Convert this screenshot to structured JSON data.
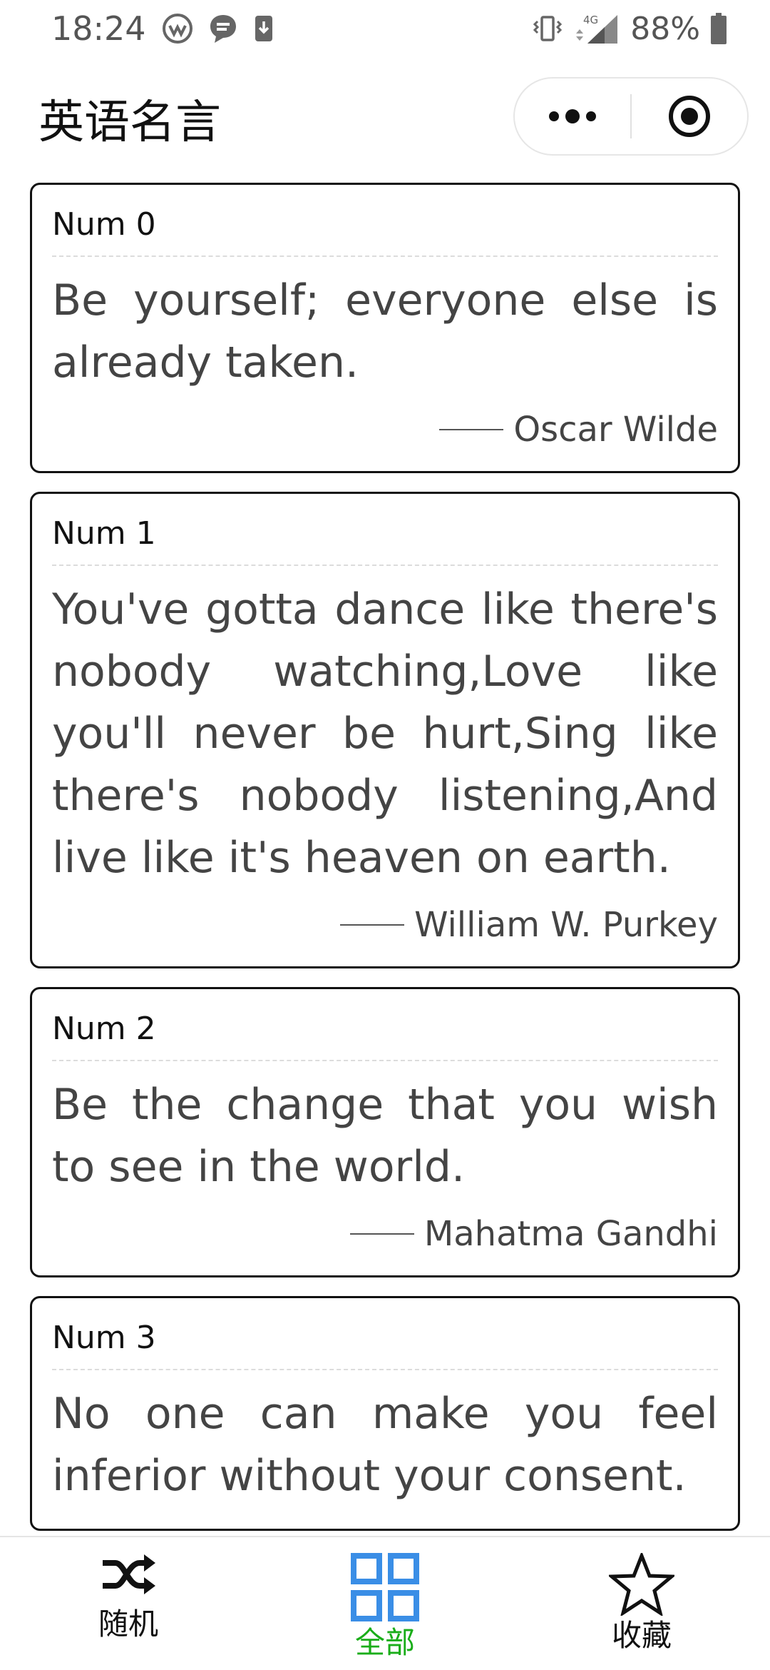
{
  "status_bar": {
    "time": "18:24",
    "battery": "88%",
    "network": "4G"
  },
  "nav": {
    "title": "英语名言"
  },
  "quotes": [
    {
      "num": "Num 0",
      "text": "Be yourself; everyone else is already taken.",
      "author": "Oscar Wilde"
    },
    {
      "num": "Num 1",
      "text": "You've gotta dance like there's nobody watching,Love like you'll never be hurt,Sing like there's nobody listening,And live like it's heaven on earth.",
      "author": "William W. Purkey"
    },
    {
      "num": "Num 2",
      "text": "Be the change that you wish to see in the world.",
      "author": "Mahatma Gandhi"
    },
    {
      "num": "Num 3",
      "text": "No one can make you feel inferior without your consent.",
      "author": ""
    }
  ],
  "tabs": [
    {
      "label": "随机",
      "icon": "shuffle-icon",
      "active": false
    },
    {
      "label": "全部",
      "icon": "grid-icon",
      "active": true
    },
    {
      "label": "收藏",
      "icon": "star-icon",
      "active": false
    }
  ],
  "colors": {
    "active_tab": "#1aad19",
    "active_icon": "#3a8ee6",
    "text": "#444444",
    "border": "#111111"
  }
}
